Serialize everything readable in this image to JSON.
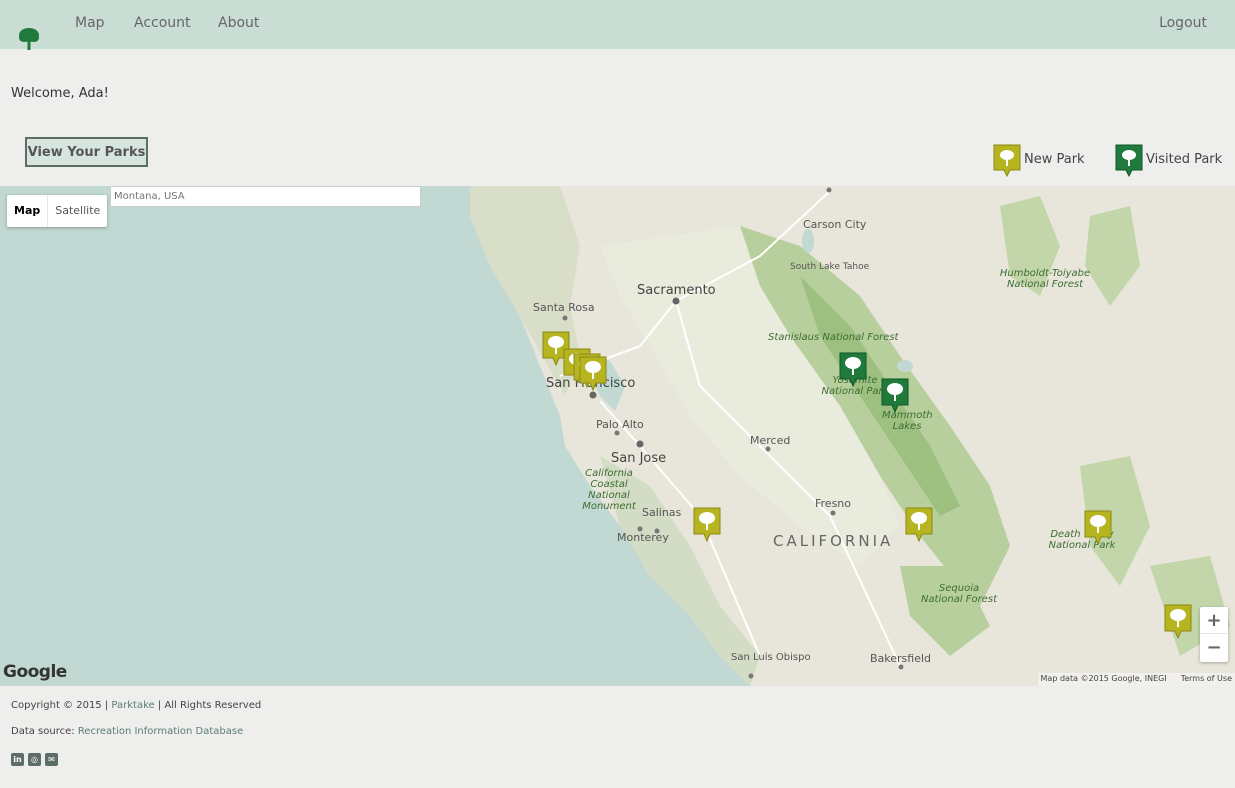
{
  "nav": {
    "brand_icon": "tree-logo-icon",
    "links": [
      "Map",
      "Account",
      "About"
    ],
    "logout": "Logout"
  },
  "welcome": "Welcome, Ada!",
  "view_parks_button": "View Your Parks",
  "legend": {
    "new_label": "New Park",
    "visited_label": "Visited Park",
    "new_color": "#b6b41f",
    "visited_color": "#1f7a3c"
  },
  "map": {
    "search_placeholder": "Montana, USA",
    "map_type_active": "Map",
    "map_type_other": "Satellite",
    "zoom_in": "+",
    "zoom_out": "−",
    "google_logo": "Google",
    "attribution": "Map data ©2015 Google, INEGI",
    "terms": "Terms of Use",
    "labels": {
      "carson_city": "Carson City",
      "south_lake_tahoe": "South Lake Tahoe",
      "sacramento": "Sacramento",
      "santa_rosa": "Santa Rosa",
      "san_francisco": "San Francisco",
      "palo_alto": "Palo Alto",
      "san_jose": "San Jose",
      "merced": "Merced",
      "fresno": "Fresno",
      "salinas": "Salinas",
      "monterey": "Monterey",
      "california": "CALIFORNIA",
      "san_luis_obispo": "San Luis Obispo",
      "bakersfield": "Bakersfield",
      "stanislaus_nf": "Stanislaus National Forest",
      "yosemite_np": "Yosemite National Park",
      "mammoth_lakes": "Mammoth Lakes",
      "humboldt_toiyabe_nf": "Humboldt-Toiyabe National Forest",
      "ca_coastal_nm": "California Coastal National Monument",
      "death_valley_np": "Death Valley National Park",
      "sequoia_nf": "Sequoia National Forest"
    },
    "markers": [
      {
        "type": "new"
      },
      {
        "type": "new"
      },
      {
        "type": "new"
      },
      {
        "type": "new"
      },
      {
        "type": "new"
      },
      {
        "type": "new"
      },
      {
        "type": "new"
      },
      {
        "type": "new"
      },
      {
        "type": "visited"
      },
      {
        "type": "visited"
      }
    ]
  },
  "footer": {
    "copyright_prefix": "Copyright © 2015 | ",
    "copyright_brand": "Parktake",
    "copyright_suffix": " | All Rights Reserved",
    "source_prefix": "Data source: ",
    "source_link": "Recreation Information Database",
    "social_icons": [
      "linkedin-icon",
      "github-icon",
      "envelope-icon"
    ]
  }
}
